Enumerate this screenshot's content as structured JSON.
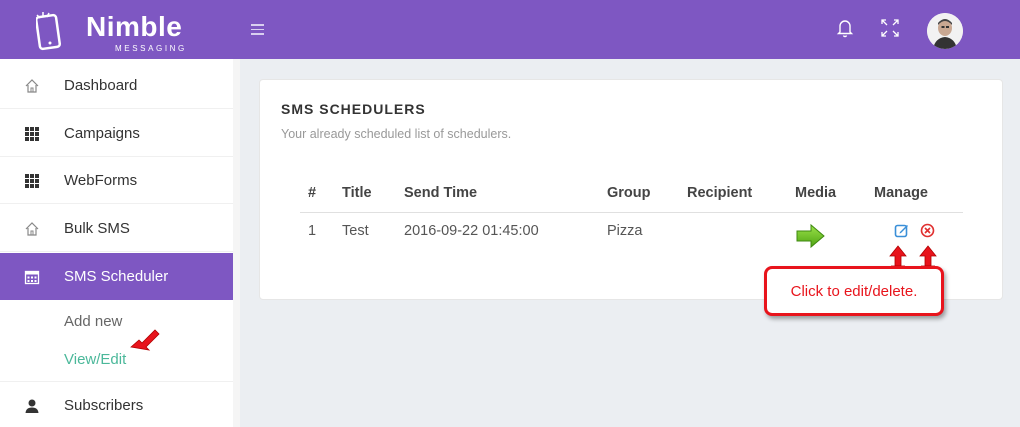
{
  "app": {
    "logo_title": "Nimble",
    "logo_subtitle": "MESSAGING"
  },
  "topbar": {
    "menu_icon": "hamburger-icon",
    "notification_icon": "bell-icon",
    "fullscreen_icon": "expand-icon",
    "avatar_icon": "user-avatar"
  },
  "sidebar": {
    "items": [
      {
        "label": "Dashboard",
        "icon": "home-icon"
      },
      {
        "label": "Campaigns",
        "icon": "grid-icon"
      },
      {
        "label": "WebForms",
        "icon": "grid-icon"
      },
      {
        "label": "Bulk SMS",
        "icon": "home-icon"
      },
      {
        "label": "SMS Scheduler",
        "icon": "calendar-icon",
        "active": true
      },
      {
        "label": "Subscribers",
        "icon": "user-icon"
      }
    ],
    "submenu": [
      {
        "label": "Add new"
      },
      {
        "label": "View/Edit",
        "active": true
      }
    ]
  },
  "main": {
    "title": "SMS SCHEDULERS",
    "subtitle": "Your already scheduled list of schedulers.",
    "table": {
      "headers": [
        "#",
        "Title",
        "Send Time",
        "Group",
        "Recipient",
        "Media",
        "Manage"
      ],
      "rows": [
        {
          "num": "1",
          "title": "Test",
          "send_time": "2016-09-22 01:45:00",
          "group": "Pizza",
          "recipient": "",
          "media_icon": "green-arrow-icon",
          "manage_icons": [
            "edit-icon",
            "delete-icon"
          ]
        }
      ]
    }
  },
  "annotation": {
    "callout_text": "Click to edit/delete."
  },
  "colors": {
    "brand": "#7e57c2",
    "active_submenu": "#4bb89a",
    "annotation_red": "#e8141c",
    "edit_blue": "#3a8fd8",
    "delete_red": "#e03030",
    "media_green": "#6cc324"
  }
}
